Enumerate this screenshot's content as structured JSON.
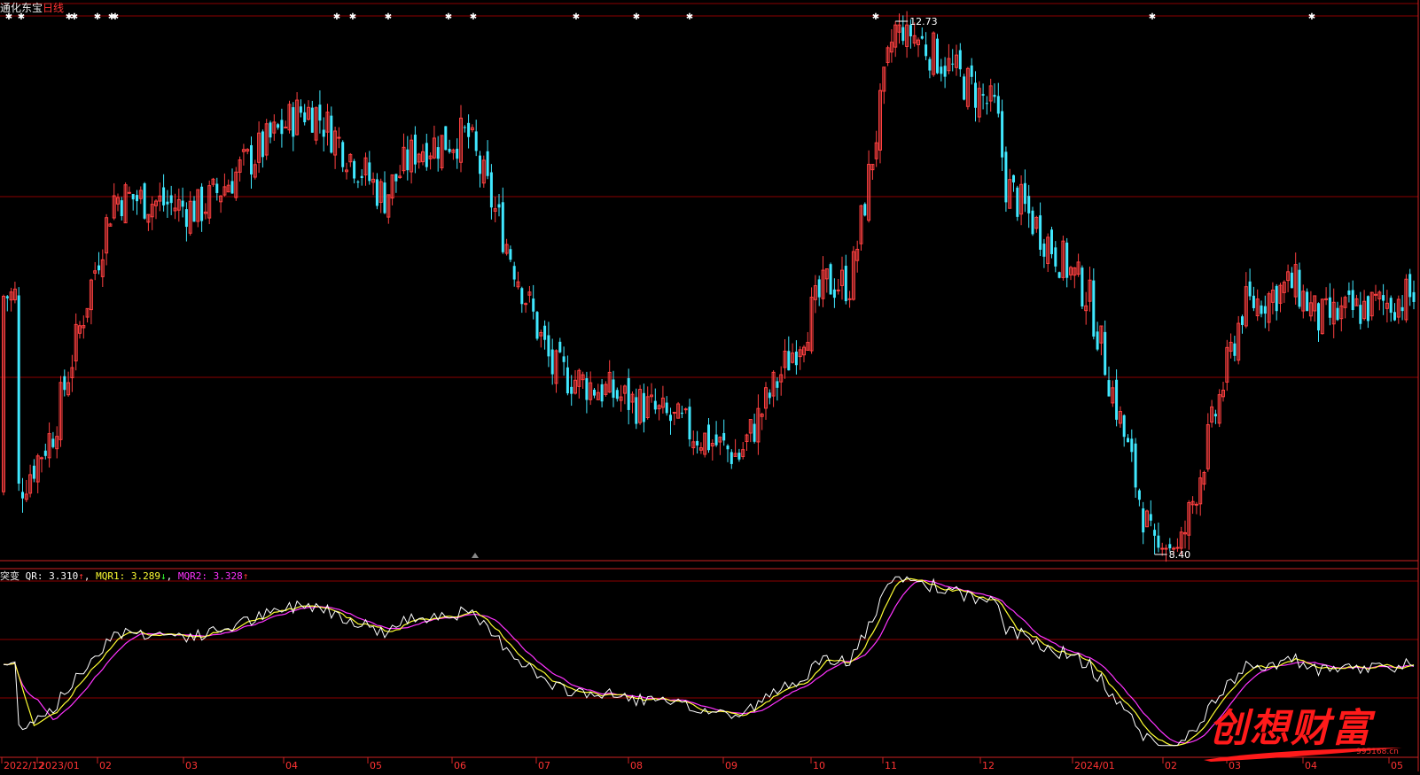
{
  "header": {
    "stock_name": "通化东宝",
    "period": "日线"
  },
  "price_panel": {
    "high_label": "12.73",
    "low_label": "8.40"
  },
  "indicator_panel": {
    "name": "突变",
    "items": [
      {
        "label": "QR",
        "value": "3.310",
        "arrow": "↑",
        "color": "#ffffff",
        "arrow_color": "#ff3333"
      },
      {
        "label": "MQR1",
        "value": "3.289",
        "arrow": "↓",
        "color": "#ffff33",
        "arrow_color": "#33ff33"
      },
      {
        "label": "MQR2",
        "value": "3.328",
        "arrow": "↑",
        "color": "#ff33ff",
        "arrow_color": "#ff3333"
      }
    ]
  },
  "watermark": {
    "text": "创想财富",
    "url": "995168.cn"
  },
  "colors": {
    "up": "#ff4040",
    "down": "#40e8ff",
    "grid": "#8b0000",
    "qr": "#ffffff",
    "mqr1": "#ffff33",
    "mqr2": "#ff33ff",
    "axis_text": "#ff3333"
  },
  "chart_data": {
    "type": "candlestick",
    "price_range": [
      8.4,
      12.73
    ],
    "x_axis_labels": [
      "2022/12",
      "2023/01",
      "02",
      "03",
      "04",
      "05",
      "06",
      "07",
      "08",
      "09",
      "10",
      "11",
      "12",
      "2024/01",
      "02",
      "03",
      "04",
      "05"
    ],
    "price_keypoints": [
      {
        "month": "2022/12",
        "price": 8.9
      },
      {
        "month": "2023/01",
        "price": 9.4
      },
      {
        "month": "02",
        "price": 11.3
      },
      {
        "month": "03",
        "price": 11.2
      },
      {
        "month": "04",
        "price": 12.0
      },
      {
        "month": "05",
        "price": 11.3
      },
      {
        "month": "06",
        "price": 11.8
      },
      {
        "month": "07",
        "price": 9.9
      },
      {
        "month": "08",
        "price": 9.6
      },
      {
        "month": "09",
        "price": 9.2
      },
      {
        "month": "10",
        "price": 10.6
      },
      {
        "month": "11",
        "price": 12.73
      },
      {
        "month": "12",
        "price": 12.0
      },
      {
        "month": "2024/01",
        "price": 10.5
      },
      {
        "month": "02",
        "price": 8.4
      },
      {
        "month": "03",
        "price": 10.4
      },
      {
        "month": "04",
        "price": 10.3
      },
      {
        "month": "05",
        "price": 10.5
      }
    ],
    "indicator_series": [
      {
        "name": "QR",
        "last": 3.31
      },
      {
        "name": "MQR1",
        "last": 3.289
      },
      {
        "name": "MQR2",
        "last": 3.328
      }
    ]
  }
}
